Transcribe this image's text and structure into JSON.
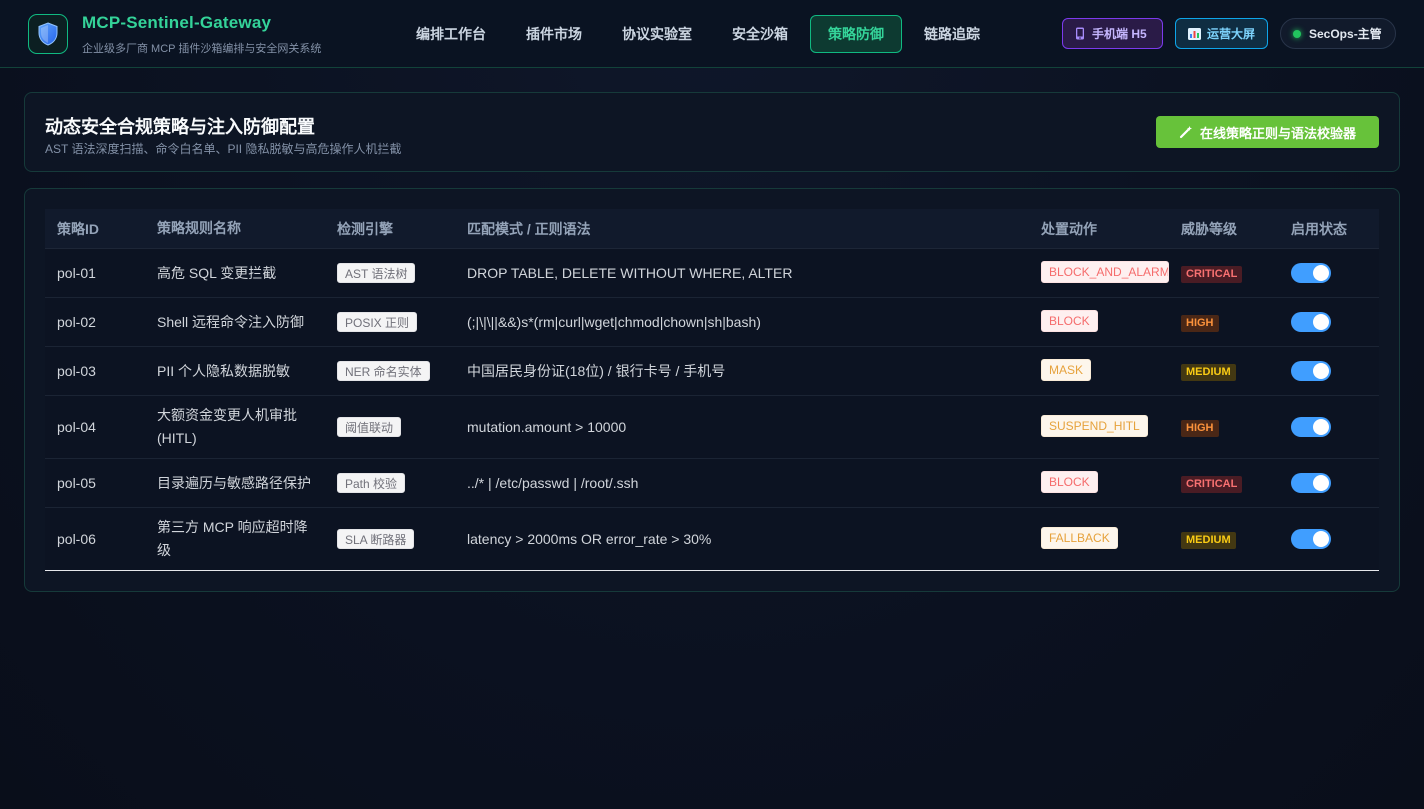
{
  "brand": {
    "title": "MCP-Sentinel-Gateway",
    "subtitle": "企业级多厂商 MCP 插件沙箱编排与安全网关系统",
    "logo_icon": "shield-icon"
  },
  "nav": [
    {
      "label": "编排工作台",
      "active": false
    },
    {
      "label": "插件市场",
      "active": false
    },
    {
      "label": "协议实验室",
      "active": false
    },
    {
      "label": "安全沙箱",
      "active": false
    },
    {
      "label": "策略防御",
      "active": true
    },
    {
      "label": "链路追踪",
      "active": false
    }
  ],
  "header_actions": {
    "mobile_label": "手机端 H5",
    "mobile_icon": "mobile-phone-icon",
    "screen_label": "运营大屏",
    "screen_icon": "bar-chart-icon",
    "user_label": "SecOps-主管",
    "user_status_color": "#22c55e"
  },
  "policy_panel": {
    "title": "动态安全合规策略与注入防御配置",
    "subtitle": "AST 语法深度扫描、命令白名单、PII 隐私脱敏与高危操作人机拦截",
    "validate_button": "在线策略正则与语法校验器",
    "validate_icon": "magic-wand-icon"
  },
  "table": {
    "columns": [
      "策略ID",
      "策略规则名称",
      "检测引擎",
      "匹配模式 / 正则语法",
      "处置动作",
      "威胁等级",
      "启用状态"
    ],
    "rows": [
      {
        "id": "pol-01",
        "name": "高危 SQL 变更拦截",
        "engine": "AST 语法树",
        "pattern": "DROP TABLE, DELETE WITHOUT WHERE, ALTER",
        "action": "BLOCK_AND_ALARM",
        "action_type": "danger",
        "level": "CRITICAL",
        "enabled": true
      },
      {
        "id": "pol-02",
        "name": "Shell 远程命令注入防御",
        "engine": "POSIX 正则",
        "pattern": "(;|\\|\\||&&)s*(rm|curl|wget|chmod|chown|sh|bash)",
        "action": "BLOCK",
        "action_type": "danger",
        "level": "HIGH",
        "enabled": true
      },
      {
        "id": "pol-03",
        "name": "PII 个人隐私数据脱敏",
        "engine": "NER 命名实体",
        "pattern": "中国居民身份证(18位) / 银行卡号 / 手机号",
        "action": "MASK",
        "action_type": "warn",
        "level": "MEDIUM",
        "enabled": true
      },
      {
        "id": "pol-04",
        "name": "大额资金变更人机审批 (HITL)",
        "engine": "阈值联动",
        "pattern": "mutation.amount > 10000",
        "action": "SUSPEND_HITL",
        "action_type": "warn",
        "level": "HIGH",
        "enabled": true
      },
      {
        "id": "pol-05",
        "name": "目录遍历与敏感路径保护",
        "engine": "Path 校验",
        "pattern": "../* | /etc/passwd | /root/.ssh",
        "action": "BLOCK",
        "action_type": "danger",
        "level": "CRITICAL",
        "enabled": true
      },
      {
        "id": "pol-06",
        "name": "第三方 MCP 响应超时降级",
        "engine": "SLA 断路器",
        "pattern": "latency > 2000ms OR error_rate > 30%",
        "action": "FALLBACK",
        "action_type": "warn",
        "level": "MEDIUM",
        "enabled": true
      }
    ]
  },
  "colors": {
    "accent": "#10b981",
    "validate_button": "#67c23a",
    "switch_on": "#409eff"
  }
}
